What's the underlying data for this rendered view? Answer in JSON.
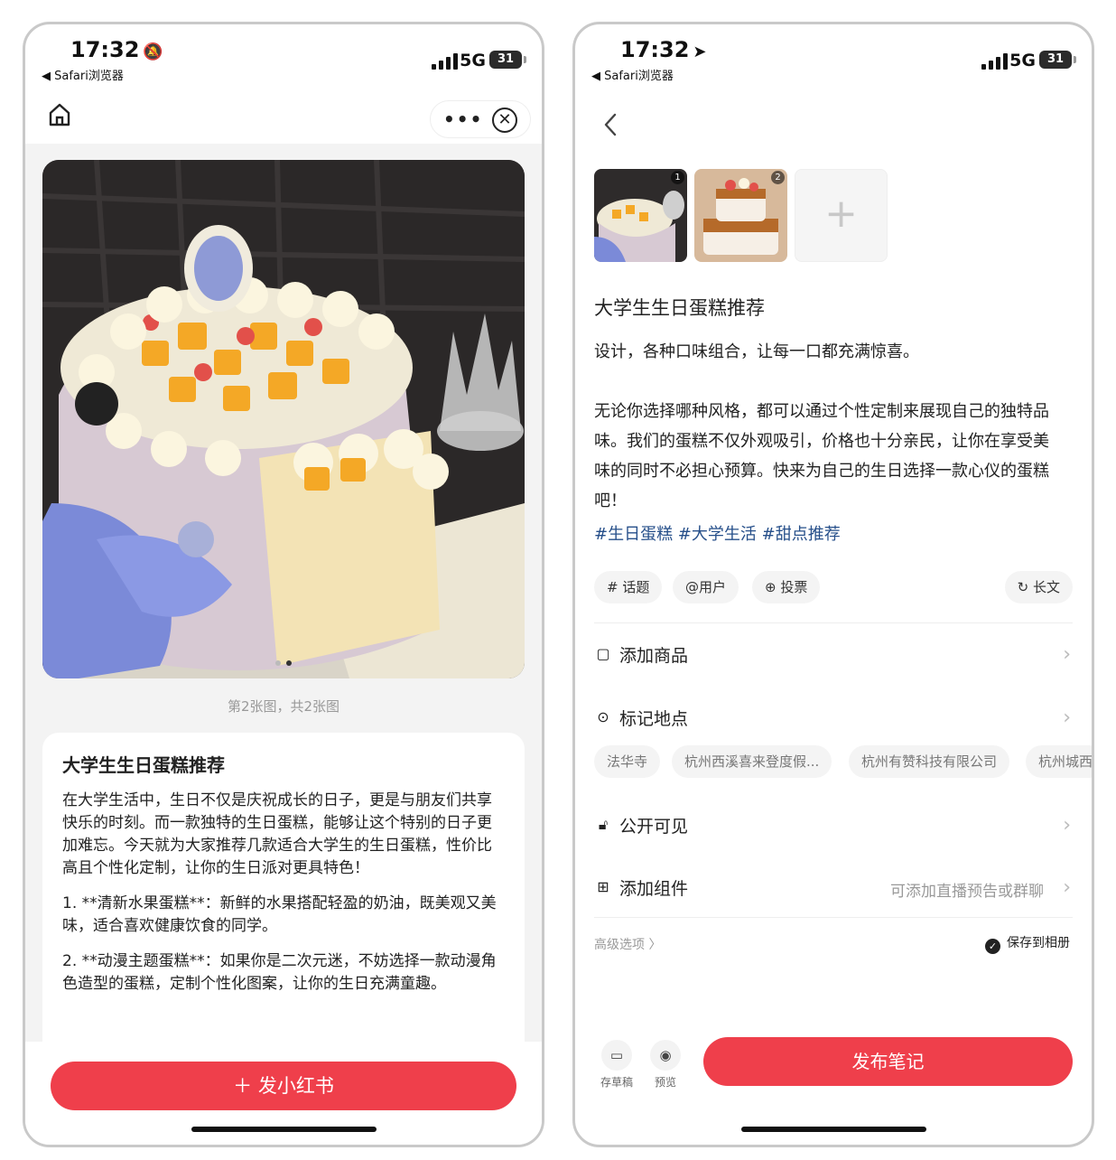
{
  "left": {
    "status": {
      "time": "17:32",
      "back_app": "◀ Safari浏览器",
      "network": "5G",
      "battery": "31"
    },
    "photo_counter": "第2张图，共2张图",
    "card": {
      "title": "大学生生日蛋糕推荐",
      "paragraphs": [
        "在大学生活中，生日不仅是庆祝成长的日子，更是与朋友们共享快乐的时刻。而一款独特的生日蛋糕，能够让这个特别的日子更加难忘。今天就为大家推荐几款适合大学生的生日蛋糕，性价比高且个性化定制，让你的生日派对更具特色！",
        "1. **清新水果蛋糕**：新鲜的水果搭配轻盈的奶油，既美观又美味，适合喜欢健康饮食的同学。",
        "2. **动漫主题蛋糕**：如果你是二次元迷，不妨选择一款动漫角色造型的蛋糕，定制个性化图案，让你的生日充满童趣。"
      ]
    },
    "post_button": "＋ 发小红书"
  },
  "right": {
    "status": {
      "time": "17:32",
      "back_app": "◀ Safari浏览器",
      "network": "5G",
      "battery": "31"
    },
    "thumb_numbers": [
      "1",
      "2"
    ],
    "add_image": "+",
    "title": "大学生生日蛋糕推荐",
    "body": [
      "设计，各种口味组合，让每一口都充满惊喜。",
      "无论你选择哪种风格，都可以通过个性定制来展现自己的独特品味。我们的蛋糕不仅外观吸引，价格也十分亲民，让你在享受美味的同时不必担心预算。快来为自己的生日选择一款心仪的蛋糕吧！"
    ],
    "tags": "#生日蛋糕 #大学生活 #甜点推荐",
    "chips": {
      "topic": "# 话题",
      "user": "@用户",
      "vote": "投票",
      "long": "长文"
    },
    "rows": {
      "add_product": "添加商品",
      "mark_location": "标记地点",
      "visibility": "公开可见",
      "add_component": "添加组件",
      "add_component_hint": "可添加直播预告或群聊"
    },
    "locations": [
      "法华寺",
      "杭州西溪喜来登度假...",
      "杭州有赞科技有限公司",
      "杭州城西"
    ],
    "advanced": "高级选项 〉",
    "save_album": "保存到相册",
    "tools": {
      "draft": "存草稿",
      "preview": "预览"
    },
    "publish_button": "发布笔记"
  }
}
